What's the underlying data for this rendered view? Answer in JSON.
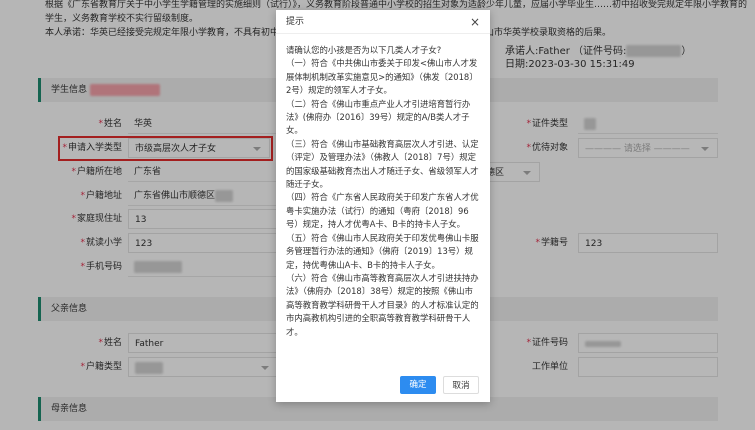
{
  "notice": {
    "line1": "根据《广东省教育厅关于中小学生学籍管理的实施细则（试行）》，义务教育阶段普通中小学校的招生对象为适龄少年儿童，应届小学毕业生……初中招收受完规定年限小学教育的",
    "line2": "学生，义务教育学校不实行留级制度。",
    "line3_left": "本人承诺：华英已经接受完规定年限小学教育，不具有初中学籍",
    "line3_right": "山市华英学校录取资格的后果。",
    "promiser": "承诺人:Father （证件号码:",
    "promiser_close": "）",
    "date": "日期:2023-03-30 15:31:49"
  },
  "sections": {
    "student": "学生信息",
    "father": "父亲信息",
    "mother": "母亲信息"
  },
  "student": {
    "name_label": "姓名",
    "name_value": "华英",
    "type_label": "申请入学类型",
    "type_value": "市级高层次人才子女",
    "province_label": "户籍所在地",
    "province_value": "广东省",
    "address_label": "户籍地址",
    "address_value": "广东省佛山市顺德区",
    "district_value": "德区",
    "home_label": "家庭现住址",
    "home_value": "13",
    "school_label": "就读小学",
    "school_value": "123",
    "phone_label": "手机号码",
    "idtype_label": "证件类型",
    "priority_label": "优待对象",
    "priority_placeholder": "———— 请选择 ————",
    "studentno_label": "学籍号",
    "studentno_value": "123"
  },
  "father": {
    "name_label": "姓名",
    "name_value": "Father",
    "hukou_label": "户籍类型",
    "id_label": "证件号码",
    "work_label": "工作单位"
  },
  "modal": {
    "title": "提示",
    "close": "×",
    "question": "请确认您的小孩是否为以下几类人才子女?",
    "items": [
      "（一）符合《中共佛山市委关于印发<佛山市人才发展体制机制改革实施意见>的通知》（佛发〔2018〕2号）规定的领军人才子女。",
      "（二）符合《佛山市重点产业人才引进培育暂行办法》(佛府办〔2016〕39号）规定的A/B类人才子女。",
      "（三）符合《佛山市基础教育高层次人才引进、认定（评定）及管理办法》（佛教人〔2018〕7号）规定的国家级基础教育杰出人才随迁子女、省级领军人才随迁子女。",
      "（四）符合《广东省人民政府关于印发广东省人才优粤卡实施办法（试行）的通知（粤府〔2018〕96号）规定，持人才优粤A卡、B卡的持卡人子女。",
      "（五）符合《佛山市人民政府关于印发优粤佛山卡服务管理暂行办法的通知》（佛府〔2019〕13号）规定，持优粤佛山A卡、B卡的持卡人子女。",
      "（六）符合《佛山市高等教育高层次人才引进扶持办法》（佛府办〔2018〕38号）规定的按照《佛山市高等教育教学科研骨干人才目录》的人才标准认定的市内高教机构引进的全职高等教育教学科研骨干人才。"
    ],
    "ok": "确定",
    "cancel": "取消"
  },
  "colors": {
    "accent": "#2d8cf0",
    "section_bar": "#1e8a6e",
    "highlight": "#e02b2b",
    "required": "#e0304e"
  }
}
